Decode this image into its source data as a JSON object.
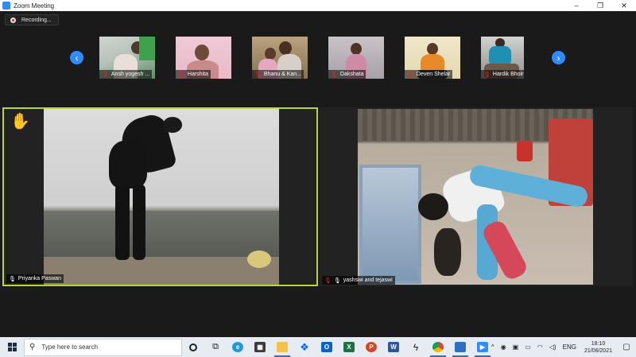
{
  "window": {
    "title": "Zoom Meeting",
    "minimize": "–",
    "maximize": "❐",
    "close": "✕"
  },
  "recording": {
    "label": "Recording..."
  },
  "strip": {
    "prev_arrow": "‹",
    "next_arrow": "›",
    "participants": [
      {
        "name": "Ansh yogesh ..."
      },
      {
        "name": "Harshita"
      },
      {
        "name": "Bhanu & Kan..."
      },
      {
        "name": "Dakshata"
      },
      {
        "name": "Deven Shelar"
      },
      {
        "name": "Hardik Bhoir"
      }
    ]
  },
  "tiles": [
    {
      "name": "Priyanka Paswan",
      "raised_hand": "✋"
    },
    {
      "name": "yashswi and tejaswi"
    }
  ],
  "taskbar": {
    "search_placeholder": "Type here to search",
    "apps": [
      "task-view",
      "widgets",
      "edge",
      "store",
      "file-explorer",
      "dropbox",
      "outlook",
      "excel",
      "powerpoint",
      "word",
      "power-automate",
      "chrome",
      "photos",
      "zoom"
    ],
    "tray": {
      "chevron": "^",
      "language": "ENG",
      "time": "18:10",
      "date": "21/06/2021"
    }
  },
  "colors": {
    "accent": "#2d8cff",
    "active_speaker": "#b8d63c",
    "muted": "#e02828"
  }
}
